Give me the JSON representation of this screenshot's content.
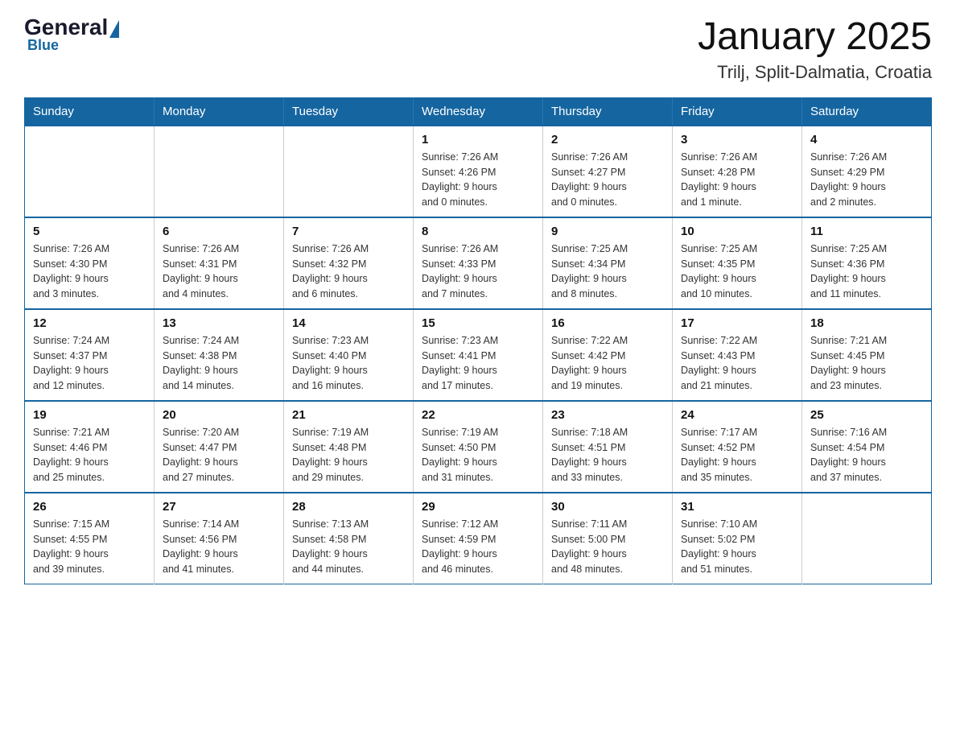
{
  "header": {
    "logo": {
      "general": "General",
      "blue": "Blue"
    },
    "month_year": "January 2025",
    "location": "Trilj, Split-Dalmatia, Croatia"
  },
  "calendar": {
    "days_of_week": [
      "Sunday",
      "Monday",
      "Tuesday",
      "Wednesday",
      "Thursday",
      "Friday",
      "Saturday"
    ],
    "weeks": [
      [
        {
          "day": "",
          "info": ""
        },
        {
          "day": "",
          "info": ""
        },
        {
          "day": "",
          "info": ""
        },
        {
          "day": "1",
          "info": "Sunrise: 7:26 AM\nSunset: 4:26 PM\nDaylight: 9 hours\nand 0 minutes."
        },
        {
          "day": "2",
          "info": "Sunrise: 7:26 AM\nSunset: 4:27 PM\nDaylight: 9 hours\nand 0 minutes."
        },
        {
          "day": "3",
          "info": "Sunrise: 7:26 AM\nSunset: 4:28 PM\nDaylight: 9 hours\nand 1 minute."
        },
        {
          "day": "4",
          "info": "Sunrise: 7:26 AM\nSunset: 4:29 PM\nDaylight: 9 hours\nand 2 minutes."
        }
      ],
      [
        {
          "day": "5",
          "info": "Sunrise: 7:26 AM\nSunset: 4:30 PM\nDaylight: 9 hours\nand 3 minutes."
        },
        {
          "day": "6",
          "info": "Sunrise: 7:26 AM\nSunset: 4:31 PM\nDaylight: 9 hours\nand 4 minutes."
        },
        {
          "day": "7",
          "info": "Sunrise: 7:26 AM\nSunset: 4:32 PM\nDaylight: 9 hours\nand 6 minutes."
        },
        {
          "day": "8",
          "info": "Sunrise: 7:26 AM\nSunset: 4:33 PM\nDaylight: 9 hours\nand 7 minutes."
        },
        {
          "day": "9",
          "info": "Sunrise: 7:25 AM\nSunset: 4:34 PM\nDaylight: 9 hours\nand 8 minutes."
        },
        {
          "day": "10",
          "info": "Sunrise: 7:25 AM\nSunset: 4:35 PM\nDaylight: 9 hours\nand 10 minutes."
        },
        {
          "day": "11",
          "info": "Sunrise: 7:25 AM\nSunset: 4:36 PM\nDaylight: 9 hours\nand 11 minutes."
        }
      ],
      [
        {
          "day": "12",
          "info": "Sunrise: 7:24 AM\nSunset: 4:37 PM\nDaylight: 9 hours\nand 12 minutes."
        },
        {
          "day": "13",
          "info": "Sunrise: 7:24 AM\nSunset: 4:38 PM\nDaylight: 9 hours\nand 14 minutes."
        },
        {
          "day": "14",
          "info": "Sunrise: 7:23 AM\nSunset: 4:40 PM\nDaylight: 9 hours\nand 16 minutes."
        },
        {
          "day": "15",
          "info": "Sunrise: 7:23 AM\nSunset: 4:41 PM\nDaylight: 9 hours\nand 17 minutes."
        },
        {
          "day": "16",
          "info": "Sunrise: 7:22 AM\nSunset: 4:42 PM\nDaylight: 9 hours\nand 19 minutes."
        },
        {
          "day": "17",
          "info": "Sunrise: 7:22 AM\nSunset: 4:43 PM\nDaylight: 9 hours\nand 21 minutes."
        },
        {
          "day": "18",
          "info": "Sunrise: 7:21 AM\nSunset: 4:45 PM\nDaylight: 9 hours\nand 23 minutes."
        }
      ],
      [
        {
          "day": "19",
          "info": "Sunrise: 7:21 AM\nSunset: 4:46 PM\nDaylight: 9 hours\nand 25 minutes."
        },
        {
          "day": "20",
          "info": "Sunrise: 7:20 AM\nSunset: 4:47 PM\nDaylight: 9 hours\nand 27 minutes."
        },
        {
          "day": "21",
          "info": "Sunrise: 7:19 AM\nSunset: 4:48 PM\nDaylight: 9 hours\nand 29 minutes."
        },
        {
          "day": "22",
          "info": "Sunrise: 7:19 AM\nSunset: 4:50 PM\nDaylight: 9 hours\nand 31 minutes."
        },
        {
          "day": "23",
          "info": "Sunrise: 7:18 AM\nSunset: 4:51 PM\nDaylight: 9 hours\nand 33 minutes."
        },
        {
          "day": "24",
          "info": "Sunrise: 7:17 AM\nSunset: 4:52 PM\nDaylight: 9 hours\nand 35 minutes."
        },
        {
          "day": "25",
          "info": "Sunrise: 7:16 AM\nSunset: 4:54 PM\nDaylight: 9 hours\nand 37 minutes."
        }
      ],
      [
        {
          "day": "26",
          "info": "Sunrise: 7:15 AM\nSunset: 4:55 PM\nDaylight: 9 hours\nand 39 minutes."
        },
        {
          "day": "27",
          "info": "Sunrise: 7:14 AM\nSunset: 4:56 PM\nDaylight: 9 hours\nand 41 minutes."
        },
        {
          "day": "28",
          "info": "Sunrise: 7:13 AM\nSunset: 4:58 PM\nDaylight: 9 hours\nand 44 minutes."
        },
        {
          "day": "29",
          "info": "Sunrise: 7:12 AM\nSunset: 4:59 PM\nDaylight: 9 hours\nand 46 minutes."
        },
        {
          "day": "30",
          "info": "Sunrise: 7:11 AM\nSunset: 5:00 PM\nDaylight: 9 hours\nand 48 minutes."
        },
        {
          "day": "31",
          "info": "Sunrise: 7:10 AM\nSunset: 5:02 PM\nDaylight: 9 hours\nand 51 minutes."
        },
        {
          "day": "",
          "info": ""
        }
      ]
    ]
  }
}
